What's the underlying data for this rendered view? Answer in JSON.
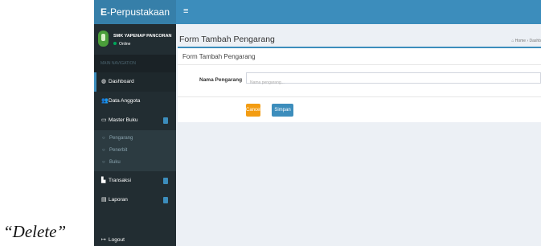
{
  "caption": "“Delete”",
  "brand": {
    "bold": "E",
    "rest": "-Perpustakaan"
  },
  "toggle_icon": "≡",
  "user": {
    "name": "SMK YAPENAP PANCORAN",
    "status": "Online"
  },
  "sidebar": {
    "header": "MAIN NAVIGATION",
    "items": [
      {
        "label": "Dashboard",
        "icon": "dashboard-icon",
        "glyph": "◍"
      },
      {
        "label": "Data Anggota",
        "icon": "users-icon",
        "glyph": "👥"
      },
      {
        "label": "Master Buku",
        "icon": "monitor-icon",
        "glyph": "▭"
      },
      {
        "label": "Transaksi",
        "icon": "chart-icon",
        "glyph": "▙"
      },
      {
        "label": "Laporan",
        "icon": "file-icon",
        "glyph": "▤"
      },
      {
        "label": "Logout",
        "icon": "logout-icon",
        "glyph": "↦"
      }
    ],
    "subitems": [
      {
        "label": "Pengarang",
        "glyph": "○"
      },
      {
        "label": "Penerbit",
        "glyph": "○"
      },
      {
        "label": "Buku",
        "glyph": "○"
      }
    ]
  },
  "page": {
    "title": "Form Tambah Pengarang",
    "breadcrumb": "⌂ Home › Dashb"
  },
  "form": {
    "box_title": "Form Tambah Pengarang",
    "field_label": "Nama Pengarang",
    "field_placeholder": "Nama pengarang...",
    "field_value": "",
    "cancel_label": "Cancel",
    "save_label": "Simpan"
  },
  "colors": {
    "topbar": "#3c8dbc",
    "sidebar": "#222d32",
    "cancel": "#f39c12",
    "save": "#3c8dbc"
  }
}
